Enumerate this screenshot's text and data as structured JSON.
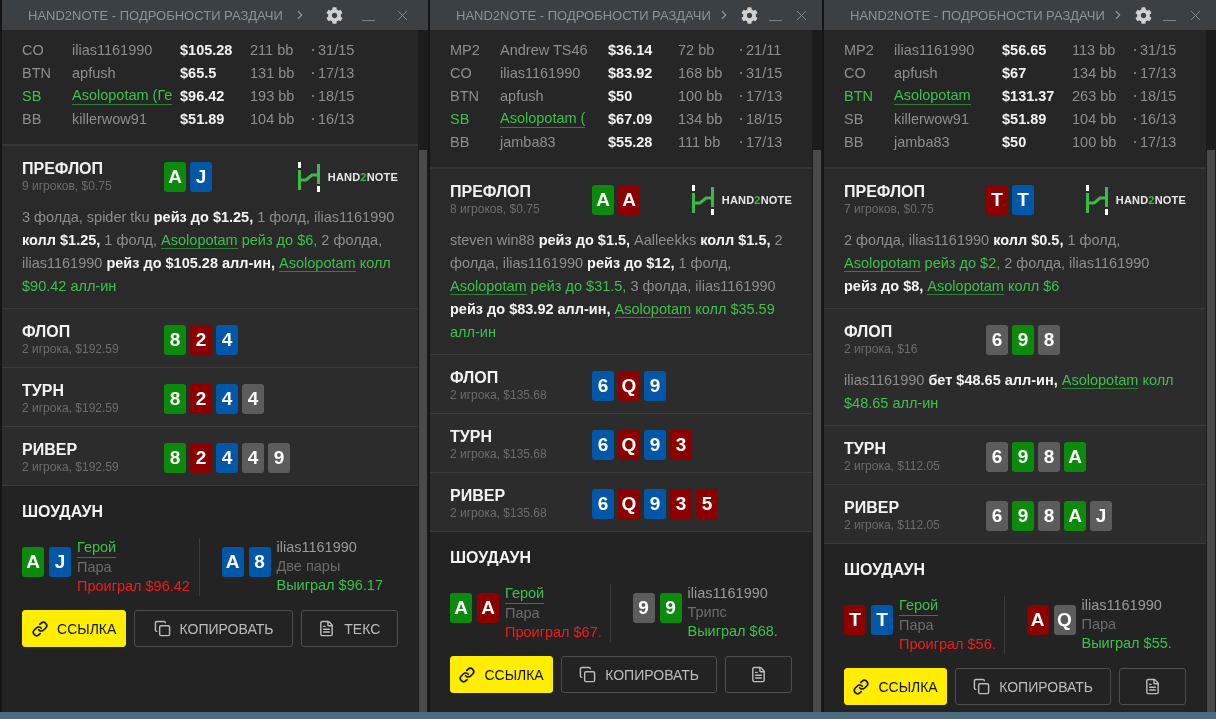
{
  "windows": [
    {
      "title": "HAND2NOTE - ПОДРОБНОСТИ РАЗДАЧИ",
      "logo": [
        "HAND",
        "2",
        "NOTE"
      ],
      "players": [
        {
          "pos": "CO",
          "name": "ilias1161990",
          "stack": "$105.28",
          "bb": "211 bb",
          "stats": "31/15",
          "hero": false
        },
        {
          "pos": "BTN",
          "name": "apfush",
          "stack": "$65.5",
          "bb": "131 bb",
          "stats": "17/13",
          "hero": false
        },
        {
          "pos": "SB",
          "name": "Asolopotam (Ге",
          "stack": "$96.42",
          "bb": "193 bb",
          "stats": "18/15",
          "hero": true
        },
        {
          "pos": "BB",
          "name": "killerwow91",
          "stack": "$51.89",
          "bb": "104 bb",
          "stats": "16/13",
          "hero": false
        }
      ],
      "streets": [
        {
          "kind": "preflop",
          "title": "ПРЕФЛОП",
          "subtitle": "9 игроков, $0.75",
          "cards": [
            {
              "rank": "A",
              "color": "#0b8a0b"
            },
            {
              "rank": "J",
              "color": "#0357a8"
            }
          ],
          "actions": [
            {
              "kind": "plain",
              "text": "3 фолда, spider tku "
            },
            {
              "kind": "action",
              "text": "рейз до $1.25,"
            },
            {
              "kind": "plain",
              "text": " 1 фолд, ilias1161990 "
            },
            {
              "kind": "action",
              "text": "колл $1.25,"
            },
            {
              "kind": "plain",
              "text": " 1 фолд, "
            },
            {
              "kind": "hero",
              "text": "Asolopotam"
            },
            {
              "kind": "hero-action",
              "text": " рейз до $6,"
            },
            {
              "kind": "plain",
              "text": " 2 фолда, ilias1161990 "
            },
            {
              "kind": "action",
              "text": "рейз до $105.28 алл-ин, "
            },
            {
              "kind": "hero",
              "text": "Asolopotam"
            },
            {
              "kind": "hero-action",
              "text": " колл $90.42 алл-ин"
            }
          ]
        },
        {
          "kind": "street",
          "title": "ФЛОП",
          "subtitle": "2 игрока, $192.59",
          "cards": [
            {
              "rank": "8",
              "color": "#0b8a0b"
            },
            {
              "rank": "2",
              "color": "#8c0000"
            },
            {
              "rank": "4",
              "color": "#0357a8"
            }
          ]
        },
        {
          "kind": "street",
          "title": "ТУРН",
          "subtitle": "2 игрока, $192.59",
          "cards": [
            {
              "rank": "8",
              "color": "#0b8a0b"
            },
            {
              "rank": "2",
              "color": "#8c0000"
            },
            {
              "rank": "4",
              "color": "#0357a8"
            },
            {
              "rank": "4",
              "color": "#5c5c5c"
            }
          ]
        },
        {
          "kind": "street",
          "title": "РИВЕР",
          "subtitle": "2 игрока, $192.59",
          "cards": [
            {
              "rank": "8",
              "color": "#0b8a0b"
            },
            {
              "rank": "2",
              "color": "#8c0000"
            },
            {
              "rank": "4",
              "color": "#0357a8"
            },
            {
              "rank": "4",
              "color": "#5c5c5c"
            },
            {
              "rank": "9",
              "color": "#5c5c5c"
            }
          ]
        }
      ],
      "showdown": {
        "title": "ШОУДАУН",
        "players": [
          {
            "cards": [
              {
                "rank": "A",
                "color": "#0b8a0b"
              },
              {
                "rank": "J",
                "color": "#0357a8"
              }
            ],
            "name": "Герой",
            "hero": true,
            "hand": "Пара",
            "result": "Проиграл $96.42",
            "won": false
          },
          {
            "cards": [
              {
                "rank": "A",
                "color": "#0357a8"
              },
              {
                "rank": "8",
                "color": "#0357a8"
              }
            ],
            "name": "ilias1161990",
            "hero": false,
            "hand": "Две пары",
            "result": "Выиграл $96.17",
            "won": true
          }
        ]
      },
      "buttons": [
        {
          "kind": "link",
          "label": "ССЫЛКА",
          "primary": true
        },
        {
          "kind": "copy",
          "label": "КОПИРОВАТЬ",
          "primary": false
        },
        {
          "kind": "text",
          "label": "ТЕКС",
          "primary": false
        }
      ]
    },
    {
      "title": "HAND2NOTE - ПОДРОБНОСТИ РАЗДАЧИ",
      "logo": [
        "HAND",
        "2",
        "NOTE"
      ],
      "players": [
        {
          "pos": "MP2",
          "name": "Andrew TS46",
          "stack": "$36.14",
          "bb": "72 bb",
          "stats": "21/11",
          "hero": false
        },
        {
          "pos": "CO",
          "name": "ilias1161990",
          "stack": "$83.92",
          "bb": "168 bb",
          "stats": "31/15",
          "hero": false
        },
        {
          "pos": "BTN",
          "name": "apfush",
          "stack": "$50",
          "bb": "100 bb",
          "stats": "17/13",
          "hero": false
        },
        {
          "pos": "SB",
          "name": "Asolopotam (",
          "stack": "$67.09",
          "bb": "134 bb",
          "stats": "18/15",
          "hero": true
        },
        {
          "pos": "BB",
          "name": "jamba83",
          "stack": "$55.28",
          "bb": "111 bb",
          "stats": "17/13",
          "hero": false
        }
      ],
      "streets": [
        {
          "kind": "preflop",
          "title": "ПРЕФЛОП",
          "subtitle": "8 игроков, $0.75",
          "cards": [
            {
              "rank": "A",
              "color": "#0b8a0b"
            },
            {
              "rank": "A",
              "color": "#8c0000"
            }
          ],
          "actions": [
            {
              "kind": "plain",
              "text": "steven win88 "
            },
            {
              "kind": "action",
              "text": "рейз до $1.5,"
            },
            {
              "kind": "plain",
              "text": " Aalleekks "
            },
            {
              "kind": "action",
              "text": "колл $1.5,"
            },
            {
              "kind": "plain",
              "text": " 2 фолда, ilias1161990 "
            },
            {
              "kind": "action",
              "text": "рейз до $12,"
            },
            {
              "kind": "plain",
              "text": " 1 фолд, "
            },
            {
              "kind": "hero",
              "text": "Asolopotam"
            },
            {
              "kind": "hero-action",
              "text": " рейз до $31.5,"
            },
            {
              "kind": "plain",
              "text": " 3 фолда, ilias1161990 "
            },
            {
              "kind": "action",
              "text": "рейз до $83.92 алл-ин, "
            },
            {
              "kind": "hero",
              "text": "Asolopotam"
            },
            {
              "kind": "hero-action",
              "text": " колл $35.59 алл-ин"
            }
          ]
        },
        {
          "kind": "street",
          "title": "ФЛОП",
          "subtitle": "2 игрока, $135.68",
          "cards": [
            {
              "rank": "6",
              "color": "#0357a8"
            },
            {
              "rank": "Q",
              "color": "#8c0000"
            },
            {
              "rank": "9",
              "color": "#0357a8"
            }
          ]
        },
        {
          "kind": "street",
          "title": "ТУРН",
          "subtitle": "2 игрока, $135.68",
          "cards": [
            {
              "rank": "6",
              "color": "#0357a8"
            },
            {
              "rank": "Q",
              "color": "#8c0000"
            },
            {
              "rank": "9",
              "color": "#0357a8"
            },
            {
              "rank": "3",
              "color": "#8c0000"
            }
          ]
        },
        {
          "kind": "street",
          "title": "РИВЕР",
          "subtitle": "2 игрока, $135.68",
          "cards": [
            {
              "rank": "6",
              "color": "#0357a8"
            },
            {
              "rank": "Q",
              "color": "#8c0000"
            },
            {
              "rank": "9",
              "color": "#0357a8"
            },
            {
              "rank": "3",
              "color": "#8c0000"
            },
            {
              "rank": "5",
              "color": "#8c0000"
            }
          ]
        }
      ],
      "showdown": {
        "title": "ШОУДАУН",
        "players": [
          {
            "cards": [
              {
                "rank": "A",
                "color": "#0b8a0b"
              },
              {
                "rank": "A",
                "color": "#8c0000"
              }
            ],
            "name": "Герой",
            "hero": true,
            "hand": "Пара",
            "result": "Проиграл $67.",
            "won": false
          },
          {
            "cards": [
              {
                "rank": "9",
                "color": "#5c5c5c"
              },
              {
                "rank": "9",
                "color": "#0b8a0b"
              }
            ],
            "name": "ilias1161990",
            "hero": false,
            "hand": "Трипс",
            "result": "Выиграл $68.",
            "won": true
          }
        ]
      },
      "buttons": [
        {
          "kind": "link",
          "label": "ССЫЛКА",
          "primary": true
        },
        {
          "kind": "copy",
          "label": "КОПИРОВАТЬ",
          "primary": false
        },
        {
          "kind": "text",
          "primary": false
        }
      ]
    },
    {
      "title": "HAND2NOTE - ПОДРОБНОСТИ РАЗДАЧИ",
      "logo": [
        "HAND",
        "2",
        "NOTE"
      ],
      "players": [
        {
          "pos": "MP2",
          "name": "ilias1161990",
          "stack": "$56.65",
          "bb": "113 bb",
          "stats": "31/15",
          "hero": false
        },
        {
          "pos": "CO",
          "name": "apfush",
          "stack": "$67",
          "bb": "134 bb",
          "stats": "17/13",
          "hero": false
        },
        {
          "pos": "BTN",
          "name": "Asolopotam",
          "stack": "$131.37",
          "bb": "263 bb",
          "stats": "18/15",
          "hero": true
        },
        {
          "pos": "SB",
          "name": "killerwow91",
          "stack": "$51.89",
          "bb": "104 bb",
          "stats": "16/13",
          "hero": false
        },
        {
          "pos": "BB",
          "name": "jamba83",
          "stack": "$50",
          "bb": "100 bb",
          "stats": "17/13",
          "hero": false
        }
      ],
      "streets": [
        {
          "kind": "preflop",
          "title": "ПРЕФЛОП",
          "subtitle": "7 игроков, $0.75",
          "cards": [
            {
              "rank": "T",
              "color": "#8c0000"
            },
            {
              "rank": "T",
              "color": "#0357a8"
            }
          ],
          "actions": [
            {
              "kind": "plain",
              "text": "2 фолда, ilias1161990 "
            },
            {
              "kind": "action",
              "text": "колл $0.5,"
            },
            {
              "kind": "plain",
              "text": " 1 фолд, "
            },
            {
              "kind": "hero",
              "text": "Asolopotam"
            },
            {
              "kind": "hero-action",
              "text": " рейз до $2,"
            },
            {
              "kind": "plain",
              "text": " 2 фолда, ilias1161990 "
            },
            {
              "kind": "action",
              "text": "рейз до $8, "
            },
            {
              "kind": "hero",
              "text": "Asolopotam"
            },
            {
              "kind": "hero-action",
              "text": " колл $6"
            }
          ]
        },
        {
          "kind": "street",
          "title": "ФЛОП",
          "subtitle": "2 игрока, $16",
          "cards": [
            {
              "rank": "6",
              "color": "#5c5c5c"
            },
            {
              "rank": "9",
              "color": "#0b8a0b"
            },
            {
              "rank": "8",
              "color": "#5c5c5c"
            }
          ],
          "actions": [
            {
              "kind": "plain",
              "text": "ilias1161990 "
            },
            {
              "kind": "action",
              "text": "бет $48.65 алл-ин, "
            },
            {
              "kind": "hero",
              "text": "Asolopotam"
            },
            {
              "kind": "hero-action",
              "text": " колл $48.65 алл-ин"
            }
          ]
        },
        {
          "kind": "street",
          "title": "ТУРН",
          "subtitle": "2 игрока, $112.05",
          "cards": [
            {
              "rank": "6",
              "color": "#5c5c5c"
            },
            {
              "rank": "9",
              "color": "#0b8a0b"
            },
            {
              "rank": "8",
              "color": "#5c5c5c"
            },
            {
              "rank": "A",
              "color": "#0b8a0b"
            }
          ]
        },
        {
          "kind": "street",
          "title": "РИВЕР",
          "subtitle": "2 игрока, $112.05",
          "cards": [
            {
              "rank": "6",
              "color": "#5c5c5c"
            },
            {
              "rank": "9",
              "color": "#0b8a0b"
            },
            {
              "rank": "8",
              "color": "#5c5c5c"
            },
            {
              "rank": "A",
              "color": "#0b8a0b"
            },
            {
              "rank": "J",
              "color": "#5c5c5c"
            }
          ]
        }
      ],
      "showdown": {
        "title": "ШОУДАУН",
        "players": [
          {
            "cards": [
              {
                "rank": "T",
                "color": "#8c0000"
              },
              {
                "rank": "T",
                "color": "#0357a8"
              }
            ],
            "name": "Герой",
            "hero": true,
            "hand": "Пара",
            "result": "Проиграл $56.",
            "won": false
          },
          {
            "cards": [
              {
                "rank": "A",
                "color": "#8c0000"
              },
              {
                "rank": "Q",
                "color": "#5c5c5c"
              }
            ],
            "name": "ilias1161990",
            "hero": false,
            "hand": "Пара",
            "result": "Выиграл $55.",
            "won": true
          }
        ]
      },
      "buttons": [
        {
          "kind": "link",
          "label": "ССЫЛКА",
          "primary": true
        },
        {
          "kind": "copy",
          "label": "КОПИРОВАТЬ",
          "primary": false
        },
        {
          "kind": "text",
          "primary": false
        }
      ]
    }
  ]
}
